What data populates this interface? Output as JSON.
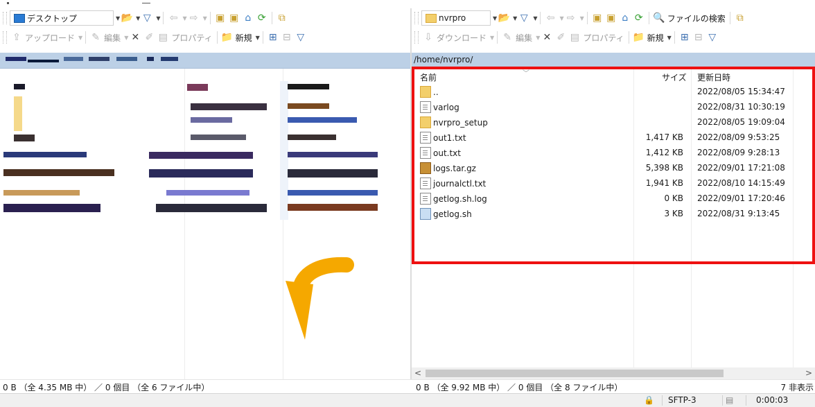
{
  "left_pane": {
    "location": "デスクトップ",
    "toolbar2": {
      "upload": "アップロード",
      "edit": "編集",
      "properties": "プロパティ",
      "new": "新規"
    },
    "status": "0 B （全 4.35 MB 中） ／ 0 個目 （全 6 ファイル中）"
  },
  "right_pane": {
    "location": "nvrpro",
    "find_files": "ファイルの検索",
    "toolbar2": {
      "download": "ダウンロード",
      "edit": "編集",
      "properties": "プロパティ",
      "new": "新規"
    },
    "path": "/home/nvrpro/",
    "columns": {
      "name": "名前",
      "size": "サイズ",
      "modified": "更新日時"
    },
    "files": [
      {
        "name": "..",
        "size": "",
        "modified": "2022/08/05 15:34:47",
        "icon": "parent-dir-icon"
      },
      {
        "name": "varlog",
        "size": "",
        "modified": "2022/08/31 10:30:19",
        "icon": "symlink-icon"
      },
      {
        "name": "nvrpro_setup",
        "size": "",
        "modified": "2022/08/05 19:09:04",
        "icon": "folder-icon"
      },
      {
        "name": "out1.txt",
        "size": "1,417 KB",
        "modified": "2022/08/09 9:53:25",
        "icon": "text-file-icon"
      },
      {
        "name": "out.txt",
        "size": "1,412 KB",
        "modified": "2022/08/09 9:28:13",
        "icon": "text-file-icon"
      },
      {
        "name": "logs.tar.gz",
        "size": "5,398 KB",
        "modified": "2022/09/01 17:21:08",
        "icon": "archive-icon"
      },
      {
        "name": "journalctl.txt",
        "size": "1,941 KB",
        "modified": "2022/08/10 14:15:49",
        "icon": "text-file-icon"
      },
      {
        "name": "getlog.sh.log",
        "size": "0 KB",
        "modified": "2022/09/01 17:20:46",
        "icon": "text-file-icon"
      },
      {
        "name": "getlog.sh",
        "size": "3 KB",
        "modified": "2022/08/31 9:13:45",
        "icon": "script-file-icon"
      }
    ],
    "status": "0 B （全 9.92 MB 中） ／ 0 個目 （全 8 ファイル中）",
    "hidden_count": "7 非表示"
  },
  "bottom": {
    "protocol": "SFTP-3",
    "elapsed": "0:00:03"
  },
  "colors": {
    "highlight_box": "#ee1111",
    "arrow": "#f5a800",
    "path_bar": "#bcd0e6"
  }
}
